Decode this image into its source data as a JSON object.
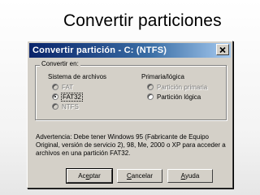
{
  "slide": {
    "title": "Convertir particiones"
  },
  "dialog": {
    "title": "Convertir partición - C: (NTFS)",
    "group_label": "Convertir en:",
    "filesystem": {
      "label": "Sistema de archivos",
      "options": [
        {
          "label": "FAT",
          "checked": false,
          "enabled": false
        },
        {
          "label": "FAT32",
          "checked": true,
          "enabled": true
        },
        {
          "label": "NTFS",
          "checked": false,
          "enabled": false
        }
      ]
    },
    "partition_type": {
      "label": "Primaria/lógica",
      "options": [
        {
          "label": "Partición primaria",
          "checked": false,
          "enabled": false
        },
        {
          "label": "Partición lógica",
          "checked": false,
          "enabled": true
        }
      ]
    },
    "warning": "Advertencia: Debe tener Windows 95 (Fabricante de Equipo Original, versión de servicio 2), 98, Me, 2000 o XP para acceder a archivos en una partición FAT32.",
    "buttons": {
      "accept": {
        "pre": "Ac",
        "key": "e",
        "post": "ptar"
      },
      "cancel": {
        "pre": "",
        "key": "C",
        "post": "ancelar"
      },
      "help": {
        "pre": "",
        "key": "A",
        "post": "yuda"
      }
    }
  }
}
